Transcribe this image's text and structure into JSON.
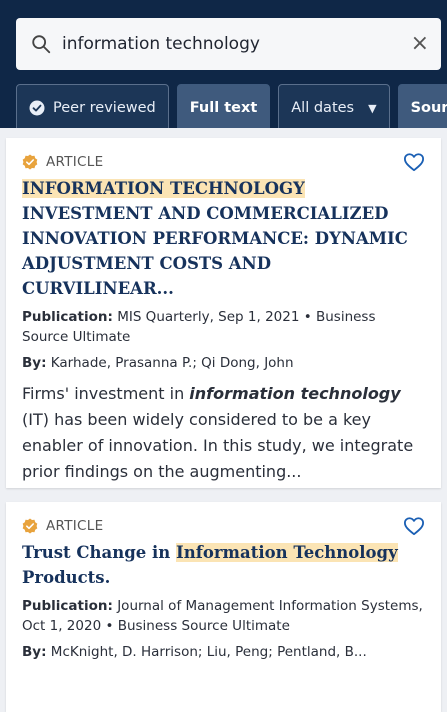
{
  "search": {
    "value": "information technology",
    "clear_label": "×"
  },
  "filters": {
    "peer_reviewed": "Peer reviewed",
    "full_text": "Full text",
    "all_dates": "All dates",
    "source_partial": "Sour"
  },
  "results": [
    {
      "type": "ARTICLE",
      "title_highlight": "INFORMATION TECHNOLOGY",
      "title_rest": " INVESTMENT AND COMMERCIALIZED INNOVATION PERFORMANCE: DYNAMIC ADJUSTMENT COSTS AND CURVILINEAR...",
      "publication_label": "Publication:",
      "publication": " MIS Quarterly, Sep 1, 2021 • Business Source Ultimate",
      "by_label": "By:",
      "authors": " Karhade, Prasanna P.; Qi Dong, John",
      "abstract_pre": "Firms' investment in ",
      "abstract_em": "information technology",
      "abstract_post": " (IT) has been widely considered to be a key enabler of innovation. In this study, we integrate prior findings on the augmenting..."
    },
    {
      "type": "ARTICLE",
      "title_pre": "Trust Change in ",
      "title_highlight": "Information Technology",
      "title_post": " Products.",
      "publication_label": "Publication:",
      "publication": " Journal of Management Information Systems, Oct 1, 2020 • Business Source Ultimate",
      "by_label": "By:",
      "authors": " McKnight, D. Harrison; Liu, Peng; Pentland, B..."
    }
  ],
  "colors": {
    "header": "#0f2747",
    "highlight": "#fbe4b4",
    "title": "#16325c",
    "badge": "#e8a33d"
  },
  "icons": [
    "search-icon",
    "close-icon",
    "check-badge-icon",
    "caret-down-icon",
    "article-badge-icon",
    "heart-icon"
  ]
}
